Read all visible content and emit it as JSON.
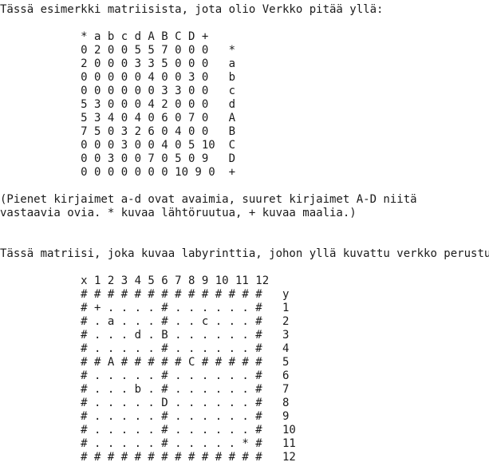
{
  "document": {
    "intro_text": "Tässä esimerkki matriisista, jota olio Verkko pitää yllä:",
    "matrix_lines": [
      "            * a b c d A B C D +",
      "            0 2 0 0 5 5 7 0 0 0   *",
      "            2 0 0 0 3 3 5 0 0 0   a",
      "            0 0 0 0 0 4 0 0 3 0   b",
      "            0 0 0 0 0 0 3 3 0 0   c",
      "            5 3 0 0 0 4 2 0 0 0   d",
      "            5 3 4 0 4 0 6 0 7 0   A",
      "            7 5 0 3 2 6 0 4 0 0   B",
      "            0 0 0 3 0 0 4 0 5 10  C",
      "            0 0 3 0 0 7 0 5 0 9   D",
      "            0 0 0 0 0 0 0 10 9 0  +"
    ],
    "note_lines": [
      "(Pienet kirjaimet a-d ovat avaimia, suuret kirjaimet A-D niitä",
      "vastaavia ovia. * kuvaa lähtöruutua, + kuvaa maalia.)"
    ],
    "maze_intro_text": "Tässä matriisi, joka kuvaa labyrinttia, johon yllä kuvattu verkko perustuu:",
    "maze_lines": [
      "            x 1 2 3 4 5 6 7 8 9 10 11 12",
      "            # # # # # # # # # # # # # #   y",
      "            # + . . . . # . . . . . . #   1",
      "            # . a . . . # . . c . . . #   2",
      "            # . . . d . B . . . . . . #   3",
      "            # . . . . . # . . . . . . #   4",
      "            # # A # # # # # C # # # # #   5",
      "            # . . . . . # . . . . . . #   6",
      "            # . . . b . # . . . . . . #   7",
      "            # . . . . . D . . . . . . #   8",
      "            # . . . . . # . . . . . . #   9",
      "            # . . . . . # . . . . . . #   10",
      "            # . . . . . # . . . . . * #   11",
      "            # # # # # # # # # # # # # #   12"
    ]
  }
}
